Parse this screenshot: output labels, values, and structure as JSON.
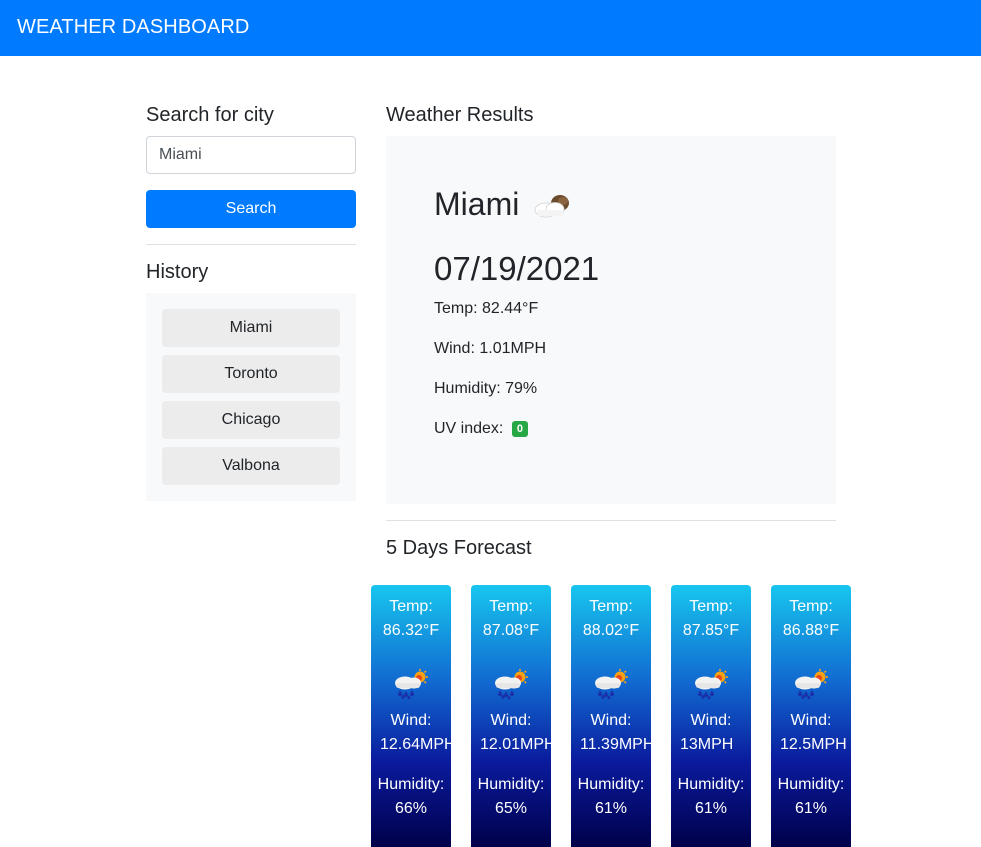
{
  "navbar": {
    "title": "WEATHER DASHBOARD"
  },
  "search": {
    "heading": "Search for city",
    "value": "Miami",
    "button_label": "Search"
  },
  "history": {
    "heading": "History",
    "items": [
      "Miami",
      "Toronto",
      "Chicago",
      "Valbona"
    ]
  },
  "results": {
    "heading": "Weather Results",
    "city": "Miami",
    "date": "07/19/2021",
    "temp": "Temp: 82.44°F",
    "wind": "Wind: 1.01MPH",
    "humidity": "Humidity: 79%",
    "uv_label": "UV index:",
    "uv_value": "0",
    "icon": "cloud-icon",
    "uv_color": "#28a745"
  },
  "forecast": {
    "heading": "5 Days Forecast",
    "temp_label": "Temp:",
    "wind_label": "Wind:",
    "humidity_label": "Humidity:",
    "icon": "rain-sun-icon",
    "days": [
      {
        "temp": "86.32°F",
        "wind": "12.64MPH",
        "humidity": "66%"
      },
      {
        "temp": "87.08°F",
        "wind": "12.01MPH",
        "humidity": "65%"
      },
      {
        "temp": "88.02°F",
        "wind": "11.39MPH",
        "humidity": "61%"
      },
      {
        "temp": "87.85°F",
        "wind": "13MPH",
        "humidity": "61%"
      },
      {
        "temp": "86.88°F",
        "wind": "12.5MPH",
        "humidity": "61%"
      }
    ]
  },
  "colors": {
    "primary": "#007bff",
    "panel": "#f8f9fa",
    "history_button": "#ececec"
  }
}
